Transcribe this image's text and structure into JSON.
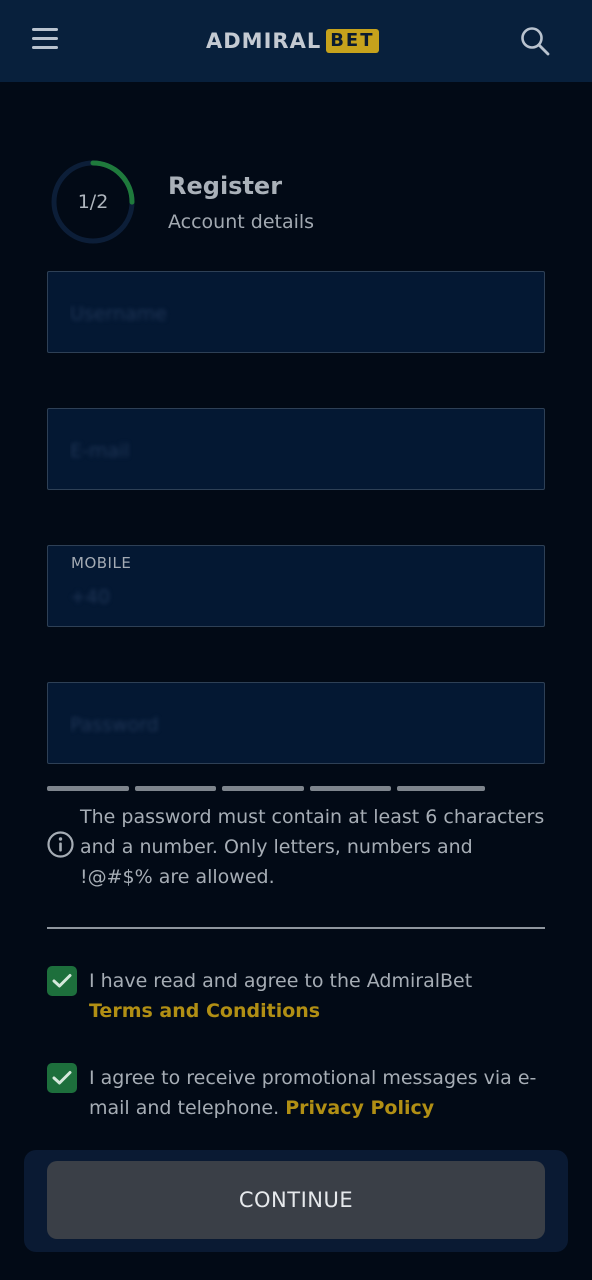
{
  "header": {
    "logo_text": "ADMIRAL",
    "logo_badge": "BET",
    "brand_color": "#c6a21c"
  },
  "progress": {
    "step_text": "1/2",
    "fraction": 0.25,
    "title": "Register",
    "subtitle": "Account details"
  },
  "form": {
    "username_placeholder": "Username",
    "email_placeholder": "E-mail",
    "mobile_label": "MOBILE",
    "mobile_prefix": "+40",
    "password_placeholder": "Password"
  },
  "password_hint": "The password must contain at least 6 characters and a number. Only letters, numbers and !@#$% are allowed.",
  "consents": {
    "terms_text": "I have read and agree to the AdmiralBet",
    "terms_link": "Terms and Conditions",
    "promo_text": "I agree to receive promotional messages via e-mail and telephone.",
    "privacy_link": "Privacy Policy"
  },
  "continue_label": "CONTINUE",
  "icons": [
    "menu-icon",
    "search-icon",
    "info-icon",
    "check-icon"
  ]
}
